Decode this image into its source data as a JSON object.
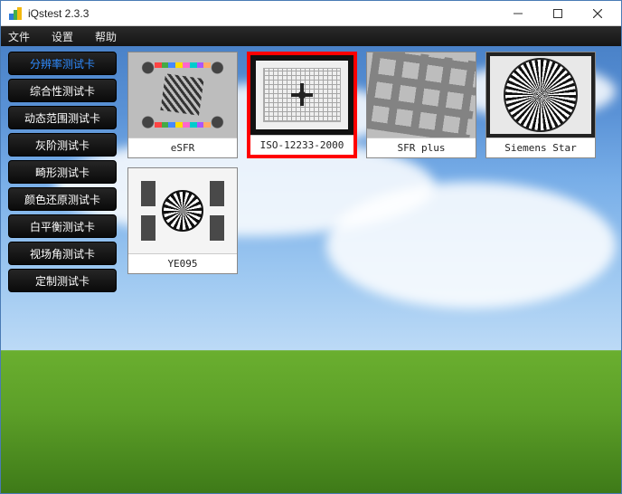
{
  "window": {
    "title": "iQstest 2.3.3"
  },
  "menu": {
    "file": "文件",
    "settings": "设置",
    "help": "帮助"
  },
  "sidebar": {
    "items": [
      {
        "label": "分辨率测试卡",
        "active": true
      },
      {
        "label": "综合性测试卡",
        "active": false
      },
      {
        "label": "动态范围测试卡",
        "active": false
      },
      {
        "label": "灰阶测试卡",
        "active": false
      },
      {
        "label": "畸形测试卡",
        "active": false
      },
      {
        "label": "颜色还原测试卡",
        "active": false
      },
      {
        "label": "白平衡测试卡",
        "active": false
      },
      {
        "label": "视场角测试卡",
        "active": false
      },
      {
        "label": "定制测试卡",
        "active": false
      }
    ]
  },
  "cards": [
    {
      "label": "eSFR",
      "selected": false,
      "thumb": "esfr"
    },
    {
      "label": "ISO-12233-2000",
      "selected": true,
      "thumb": "iso"
    },
    {
      "label": "SFR plus",
      "selected": false,
      "thumb": "sfrp"
    },
    {
      "label": "Siemens Star",
      "selected": false,
      "thumb": "siemens"
    },
    {
      "label": "YE095",
      "selected": false,
      "thumb": "ye095"
    }
  ],
  "colors": {
    "accent": "#2e8bff",
    "selection": "#f00"
  }
}
